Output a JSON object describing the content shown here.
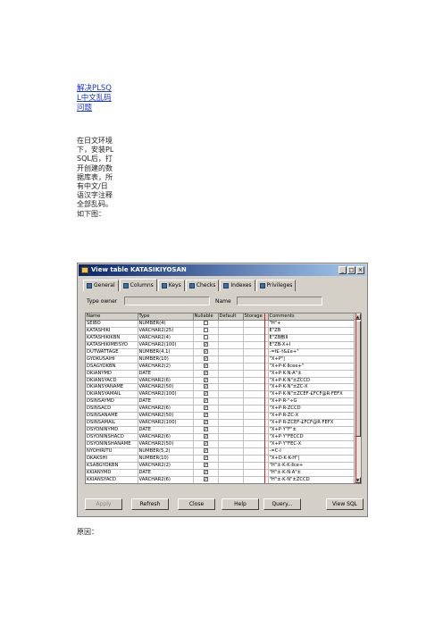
{
  "article": {
    "title": "解决PLSQL中文乱码问题",
    "intro": "在日文环境下，安装PLSQL后，打开创建的数据库表，所有中文/日语汉字注释全部乱码。如下图：",
    "cause_label": "原因："
  },
  "dialog": {
    "title": "View table KATASIKIYOSAN",
    "tabs": [
      {
        "label": "General",
        "icon": "general-tab-icon"
      },
      {
        "label": "Columns",
        "icon": "columns-tab-icon"
      },
      {
        "label": "Keys",
        "icon": "keys-tab-icon"
      },
      {
        "label": "Checks",
        "icon": "checks-tab-icon"
      },
      {
        "label": "Indexes",
        "icon": "indexes-tab-icon"
      },
      {
        "label": "Privileges",
        "icon": "privileges-tab-icon"
      }
    ],
    "active_tab": "Columns",
    "type_owner_label": "Type owner",
    "name_label": "Name",
    "columns_header": [
      "Name",
      "Type",
      "Nullable",
      "Default",
      "Storage",
      "Comments"
    ],
    "rows": [
      {
        "name": "SEIBO",
        "type": "NUMBER(4)",
        "nullable": false,
        "comment": "\"H\"+"
      },
      {
        "name": "KATASHIKI",
        "type": "VARCHAR2(25)",
        "nullable": false,
        "comment": "E\"ZB"
      },
      {
        "name": "KATASHIKIKBN",
        "type": "VARCHAR2(4)",
        "nullable": false,
        "comment": "E\"ZB敷Ⅱ"
      },
      {
        "name": "KATASHIKIMEISYO",
        "type": "VARCHAR2(100)",
        "nullable": true,
        "comment": "E\"ZB-X+I"
      },
      {
        "name": "DUTWATTAGE",
        "type": "NUMBER(4,1)",
        "nullable": true,
        "comment": "-=f£-†&£e+\""
      },
      {
        "name": "GYOKUSAIHI",
        "type": "NUMBER(10)",
        "nullable": true,
        "comment": "\"X+P\"|"
      },
      {
        "name": "DSAGYOKBN",
        "type": "VARCHAR2(2)",
        "nullable": true,
        "comment": "\"X+P-K·Ⅱcee+\""
      },
      {
        "name": "DKIANYMD",
        "type": "DATE",
        "nullable": true,
        "comment": "\"X+P·K·N·A\"±"
      },
      {
        "name": "DKIANSYACD",
        "type": "VARCHAR2(6)",
        "nullable": true,
        "comment": "\"X+P·K·N\"±ZCCD"
      },
      {
        "name": "DKIANSYANAME",
        "type": "VARCHAR2(50)",
        "nullable": true,
        "comment": "\"X+P·K·N\"±ZC-X"
      },
      {
        "name": "DKIANSYAMAIL",
        "type": "VARCHAR2(100)",
        "nullable": true,
        "comment": "\"X+P·K·N\"±ZCEF-£FCF@R·FEFX"
      },
      {
        "name": "DSINSAYMD",
        "type": "DATE",
        "nullable": true,
        "comment": "\"X+P·R-\"÷G"
      },
      {
        "name": "DSINSACD",
        "type": "VARCHAR2(6)",
        "nullable": true,
        "comment": "\"X+P·R-ZCCD"
      },
      {
        "name": "DSINSANAME",
        "type": "VARCHAR2(50)",
        "nullable": true,
        "comment": "\"X+P·R-ZC-X"
      },
      {
        "name": "DSINSAMAIL",
        "type": "VARCHAR2(100)",
        "nullable": true,
        "comment": "\"X+P·R-ZCEF-£FCF@R·FEFX"
      },
      {
        "name": "DSYONINYMD",
        "type": "DATE",
        "nullable": true,
        "comment": "\"X+P·Y\"F\"±"
      },
      {
        "name": "DSYONINSHACD",
        "type": "VARCHAR2(6)",
        "nullable": true,
        "comment": "\"X+P·Y\"FECCD"
      },
      {
        "name": "DSYONINSHANAME",
        "type": "VARCHAR2(50)",
        "nullable": true,
        "comment": "\"X+P·Y\"FEC-X"
      },
      {
        "name": "NYOHIRITU",
        "type": "NUMBER(5,2)",
        "nullable": true,
        "comment": "-=C-I"
      },
      {
        "name": "DKAKSHI",
        "type": "NUMBER(10)",
        "nullable": true,
        "comment": "\"X+D·K·K-H\"|"
      },
      {
        "name": "KSABGYOKBN",
        "type": "VARCHAR2(2)",
        "nullable": true,
        "comment": "\"H\"±·K·K·Ⅱce+"
      },
      {
        "name": "KKIANYMD",
        "type": "DATE",
        "nullable": true,
        "comment": "\"H\"±·K·N·A\"±"
      },
      {
        "name": "KKIANSYACD",
        "type": "VARCHAR2(6)",
        "nullable": true,
        "comment": "\"H\"±·K·N\"±ZCCD"
      }
    ],
    "buttons": {
      "apply": "Apply",
      "refresh": "Refresh",
      "close": "Close",
      "help": "Help",
      "query": "Query...",
      "view_sql": "View SQL"
    },
    "highlight_color": "#e02020"
  }
}
